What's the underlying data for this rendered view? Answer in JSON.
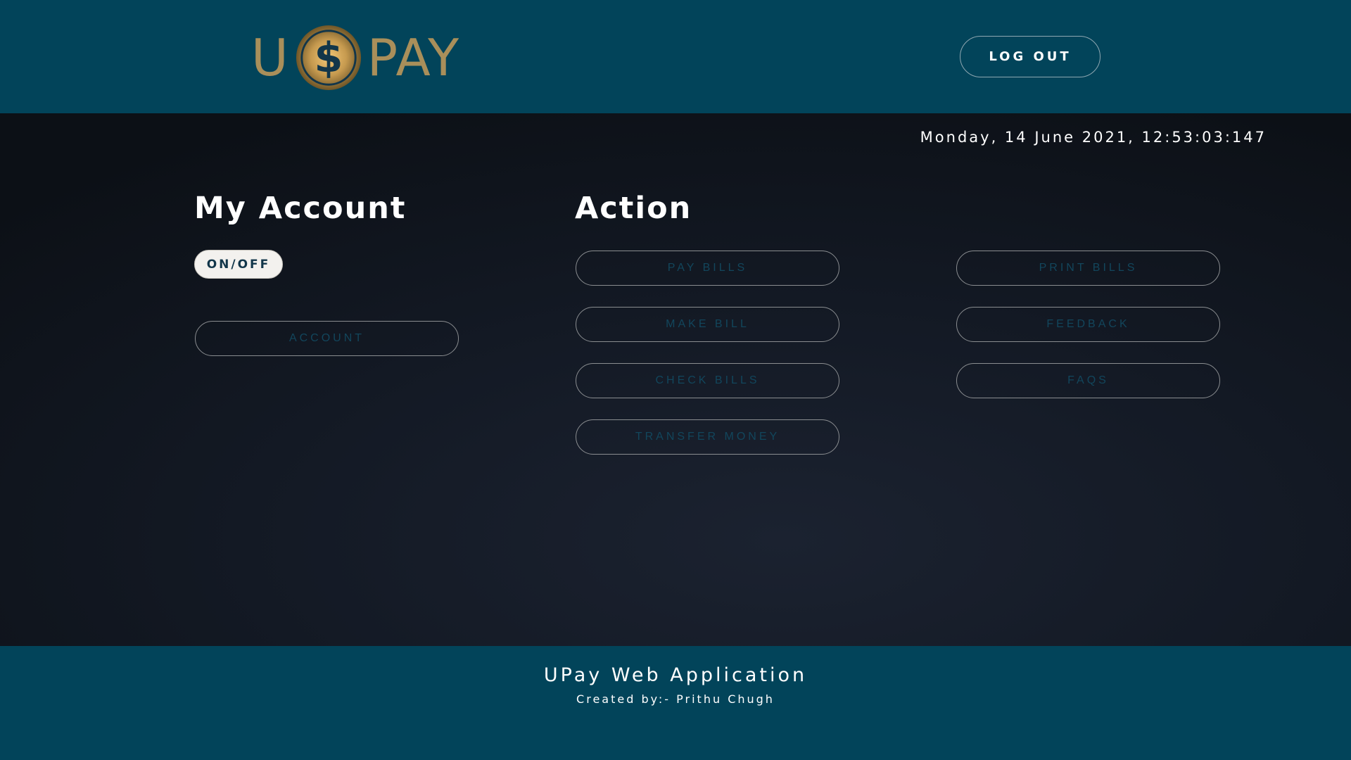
{
  "header": {
    "logo": {
      "left_text": "U",
      "coin_symbol": "$",
      "right_text": "PAY",
      "color": "#a98f5a"
    },
    "logout_label": "LOG OUT",
    "background": "#02445a"
  },
  "main": {
    "datetime": "Monday, 14 June 2021, 12:53:03:147",
    "account": {
      "title": "My Account",
      "toggle_label": "ON/OFF",
      "account_button": "ACCOUNT"
    },
    "action": {
      "title": "Action",
      "left_buttons": [
        "PAY BILLS",
        "MAKE BILL",
        "CHECK BILLS",
        "TRANSFER MONEY"
      ],
      "right_buttons": [
        "PRINT BILLS",
        "FEEDBACK",
        "FAQS"
      ]
    }
  },
  "footer": {
    "title": "UPay Web Application",
    "credit": "Created by:- Prithu Chugh"
  }
}
